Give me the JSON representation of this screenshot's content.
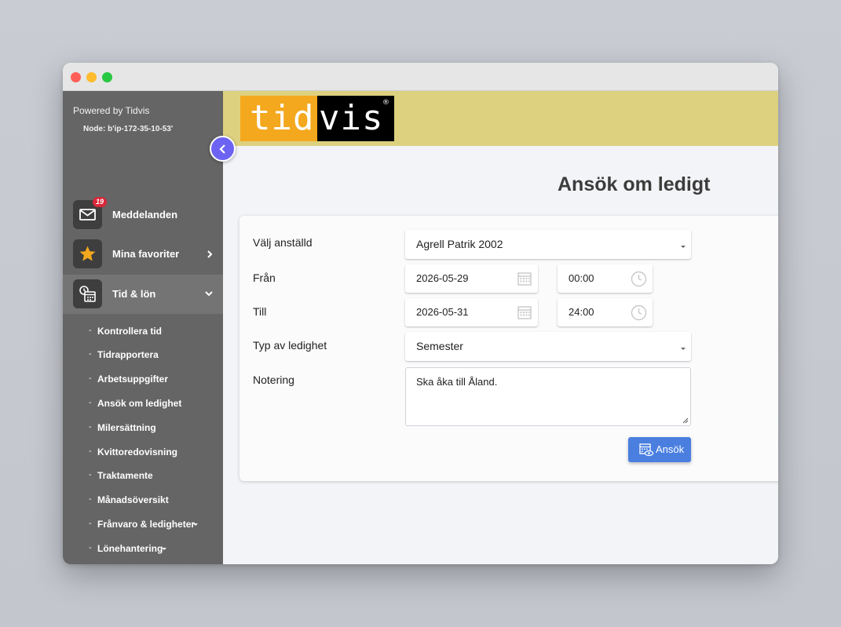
{
  "sidebar": {
    "powered_by": "Powered by Tidvis",
    "node": "Node: b'ip-172-35-10-53'",
    "items": [
      {
        "label": "Meddelanden",
        "icon": "mail-icon",
        "badge": "19"
      },
      {
        "label": "Mina favoriter",
        "icon": "star-icon"
      },
      {
        "label": "Tid & lön",
        "icon": "time-report-icon"
      }
    ],
    "submenu": [
      {
        "label": "Kontrollera tid"
      },
      {
        "label": "Tidrapportera"
      },
      {
        "label": "Arbetsuppgifter"
      },
      {
        "label": "Ansök om ledighet"
      },
      {
        "label": "Milersättning"
      },
      {
        "label": "Kvittoredovisning"
      },
      {
        "label": "Traktamente"
      },
      {
        "label": "Månadsöversikt"
      },
      {
        "label": "Frånvaro & ledigheter"
      },
      {
        "label": "Lönehantering"
      }
    ]
  },
  "header": {
    "logo_left": "tid",
    "logo_right": "vis",
    "logo_reg": "®"
  },
  "form": {
    "title": "Ansök om ledigt",
    "employee_label": "Välj anställd",
    "employee_value": "Agrell Patrik 2002",
    "from_label": "Från",
    "from_date": "2026-05-29",
    "from_time": "00:00",
    "to_label": "Till",
    "to_date": "2026-05-31",
    "to_time": "24:00",
    "type_label": "Typ av ledighet",
    "type_value": "Semester",
    "note_label": "Notering",
    "note_value": "Ska åka till Åland.",
    "submit_label": "Ansök"
  },
  "colors": {
    "sidebar_bg": "#656565",
    "header_bg": "#ddd17f",
    "logo_orange": "#f4a81d",
    "accent_button": "#4a7fe0",
    "collapse_button": "#6c63f2",
    "badge": "#d9273a"
  }
}
